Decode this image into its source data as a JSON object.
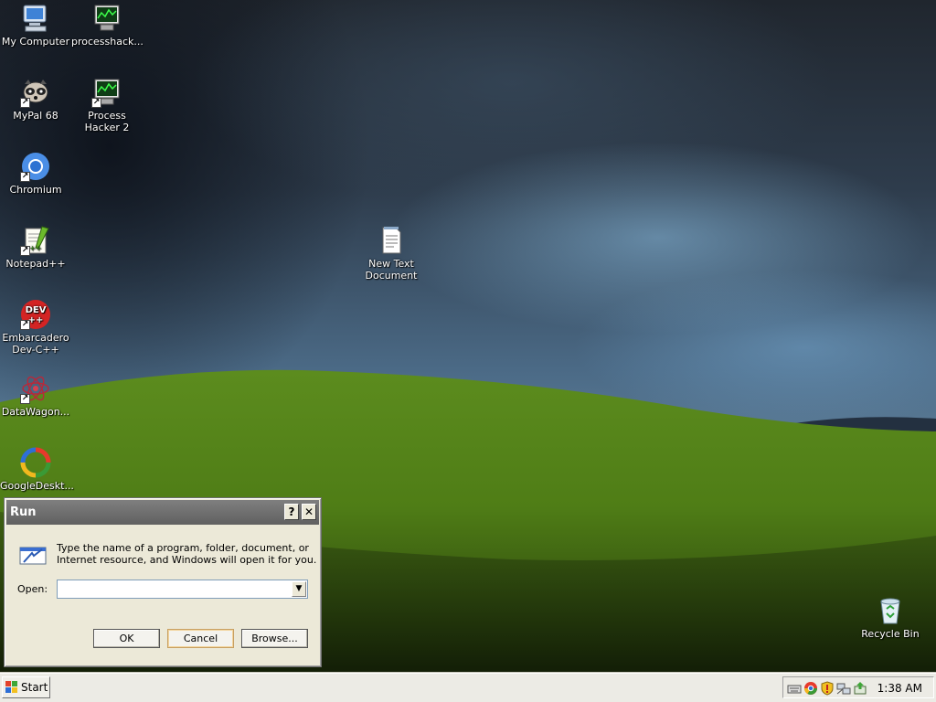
{
  "desktop": {
    "icons": [
      {
        "label": "My Computer"
      },
      {
        "label": "processhack..."
      },
      {
        "label": "MyPal 68"
      },
      {
        "label": "Process Hacker 2"
      },
      {
        "label": "Chromium"
      },
      {
        "label": "Notepad++"
      },
      {
        "label": "Embarcadero Dev-C++"
      },
      {
        "label": "DataWagon..."
      },
      {
        "label": "GoogleDeskt..."
      },
      {
        "label": "New Text Document"
      },
      {
        "label": "Recycle Bin"
      }
    ],
    "devcpp_badge": "DEV",
    "devcpp_badge_sub": "++",
    "npp_glyph": "++"
  },
  "run_dialog": {
    "title": "Run",
    "help_glyph": "?",
    "close_glyph": "✕",
    "description": "Type the name of a program, folder, document, or Internet resource, and Windows will open it for you.",
    "open_label": "Open:",
    "open_value": "",
    "dropdown_glyph": "▼",
    "ok_label": "OK",
    "cancel_label": "Cancel",
    "browse_label": "Browse..."
  },
  "taskbar": {
    "start_label": "Start",
    "clock": "1:38 AM"
  },
  "colors": {
    "grass": "#5e8d1d",
    "titlebar": "#6e6e6e",
    "dialog_bg": "#ece9d8",
    "taskbar_bg": "#ecebe5"
  }
}
